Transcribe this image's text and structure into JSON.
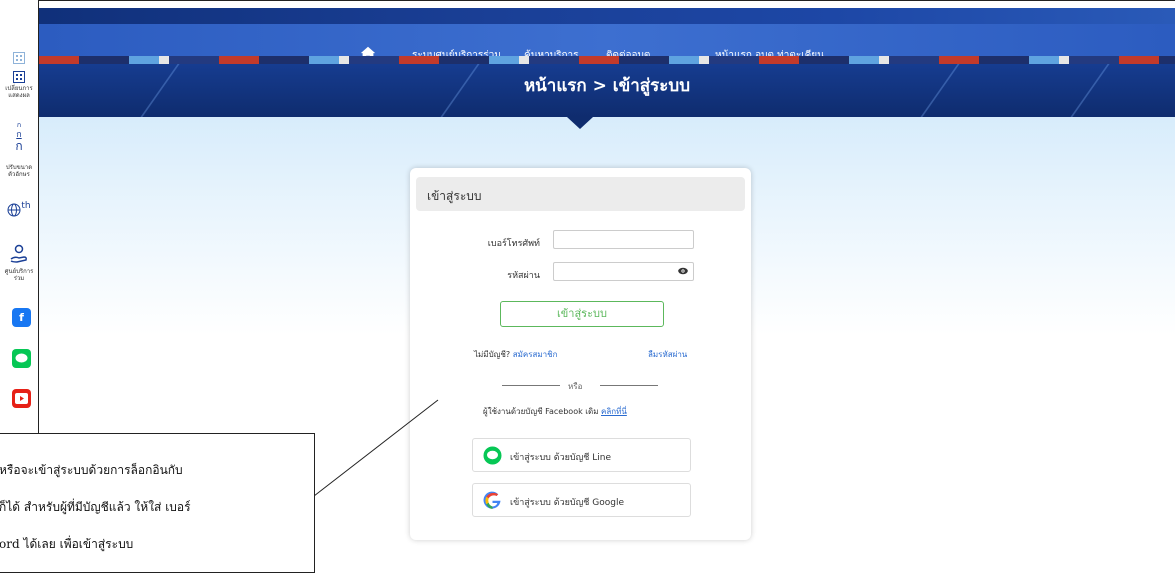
{
  "nav": {
    "items": [
      "ระบบศูนย์บริการร่วม",
      "ค้นหาบริการ",
      "ติดต่ออบต.",
      "หน้าแรก อบต.ท่าตะเคียน"
    ]
  },
  "banner": {
    "title": "หน้าแรก > เข้าสู่ระบบ"
  },
  "sidebar": {
    "display_label": "เปลี่ยนการแสดงผล",
    "font_small": "ก",
    "font_mid": "ก",
    "font_large": "ก",
    "font_label": "ปรับขนาดตัวอักษร",
    "lang_label": "th",
    "service_label": "ศูนย์บริการร่วม"
  },
  "login": {
    "header": "เข้าสู่ระบบ",
    "phone_label": "เบอร์โทรศัพท์",
    "phone_value": "",
    "password_label": "รหัสผ่าน",
    "password_value": "",
    "submit_label": "เข้าสู่ระบบ",
    "no_account_text": "ไม่มีบัญชี?",
    "register_link": "สมัครสมาชิก",
    "forgot_link": "ลืมรหัสผ่าน",
    "or_text": "หรือ",
    "facebook_text": "ผู้ใช้งานด้วยบัญชี Facebook เดิม",
    "facebook_link": "คลิกที่นี่",
    "line_button": "เข้าสู่ระบบ ด้วยบัญชี Line",
    "google_button": "เข้าสู่ระบบ ด้วยบัญชี Google"
  },
  "callout": {
    "line1": "หรือจะเข้าสู่ระบบด้วยการล็อกอินกับ",
    "line2": "ก็ได้ สำหรับผู้ที่มีบัญชีแล้ว ให้ใส่ เบอร์",
    "line3": "ord ได้เลย เพื่อเข้าสู่ระบบ"
  },
  "colors": {
    "accent": "#1a3f96",
    "success": "#5cb85c",
    "link": "#2a6bd0",
    "facebook": "#1877f2",
    "line": "#06c755",
    "youtube": "#e62117"
  }
}
